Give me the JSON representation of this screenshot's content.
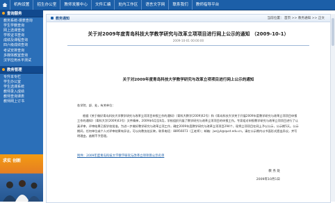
{
  "topnav": {
    "items": [
      "机构设置",
      "招生办公室",
      "教师发展中心",
      "文件汇编",
      "处内工作区",
      "语言文字网",
      "联系我们",
      "教师指导平台"
    ]
  },
  "sidebar": {
    "sections": [
      {
        "title": "查询服务",
        "items": [
          "教务系统-课表查询",
          "学生学籍查询",
          "网上选课查询",
          "学校证书查询",
          "成绩及课程查询",
          "四六级成绩查询",
          "考试安排查询",
          "多媒体教室查询",
          "汉字应用水平测试"
        ]
      },
      {
        "title": "教务管理",
        "items": [
          "专升本专栏",
          "学生办公室",
          "学生选课系统",
          "教师录入成绩",
          "教师查询课表",
          "教师网上订书"
        ]
      }
    ],
    "promo_text": "求实 创新"
  },
  "content": {
    "tab_label": "教务通知",
    "location": "当前位置： 首页 >> 教务通知 >> 正文",
    "title": "关于对2009年度青岛科技大学教学研究与改革立项项目进行网上公示的通知 （2009-10-1）",
    "meta": "2009-10-01 00:00:00",
    "subtitle": "关于对2009年度青岛科技大学教学研究与改革立项项目进行网上公示的通知",
    "greeting": "各学院、部、处，有关单位：",
    "body": "根据《关于做好青岛科技大学教学研究与改革立项项目申报工作的通知》（青科大教字[2009]42号）和《青岛科技大学关于开展2009年度教学研究与改革立项项目申报工作的通知》（青科大字[2009]43号）文件精神，2009年6月至8月，学校组织开展了教学研究与改革立项项目的申报工作。专家组对申报教学研究与改革立项项目进行了认真评审，评审结果已报学校批准。为进一步做好教学研究与改革立项工作，确定2009年度教学研究与改革立项项目294个，现将立项项目在网上予以公示，公示期5天。公示期间，任何单位或个人对评审结果有异议，可以向教务处反映，联系电话：88956073（王老师）；邮箱：jwcjyk@qust.edu.cn。请在公示期内以书面形式提出异议，并写明理由，逾期不予受理。",
    "attachment": "附件：2009年度青岛科技大学教学研究与改革立项项目公示名单",
    "signature": "教 务 处",
    "date": "2009年10月1日"
  }
}
